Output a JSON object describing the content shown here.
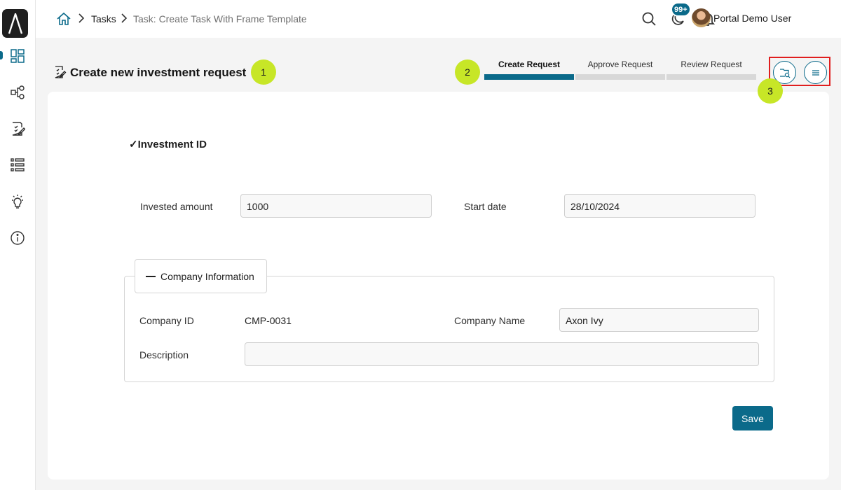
{
  "colors": {
    "accent": "#0b6a8a",
    "marker": "#c7e627",
    "highlight": "#e01e1e"
  },
  "breadcrumb": {
    "home_icon": "home-icon",
    "tasks": "Tasks",
    "current": "Task: Create Task With Frame Template"
  },
  "header": {
    "notification_badge": "99+",
    "user_name": "Portal Demo User"
  },
  "sidebar": {
    "items": [
      "dashboard-icon",
      "process-icon",
      "task-icon",
      "list-icon",
      "idea-icon",
      "info-icon"
    ]
  },
  "page": {
    "title": "Create new investment request"
  },
  "markers": {
    "m1": "1",
    "m2": "2",
    "m3": "3"
  },
  "steps": [
    {
      "label": "Create Request",
      "active": true
    },
    {
      "label": "Approve Request",
      "active": false
    },
    {
      "label": "Review Request",
      "active": false
    }
  ],
  "form": {
    "section_title": "Investment ID",
    "invested_amount_label": "Invested amount",
    "invested_amount_value": "1000",
    "start_date_label": "Start date",
    "start_date_value": "28/10/2024",
    "company_legend": "Company Information",
    "company_id_label": "Company ID",
    "company_id_value": "CMP-0031",
    "company_name_label": "Company Name",
    "company_name_value": "Axon Ivy",
    "description_label": "Description",
    "description_value": "",
    "save_label": "Save"
  }
}
